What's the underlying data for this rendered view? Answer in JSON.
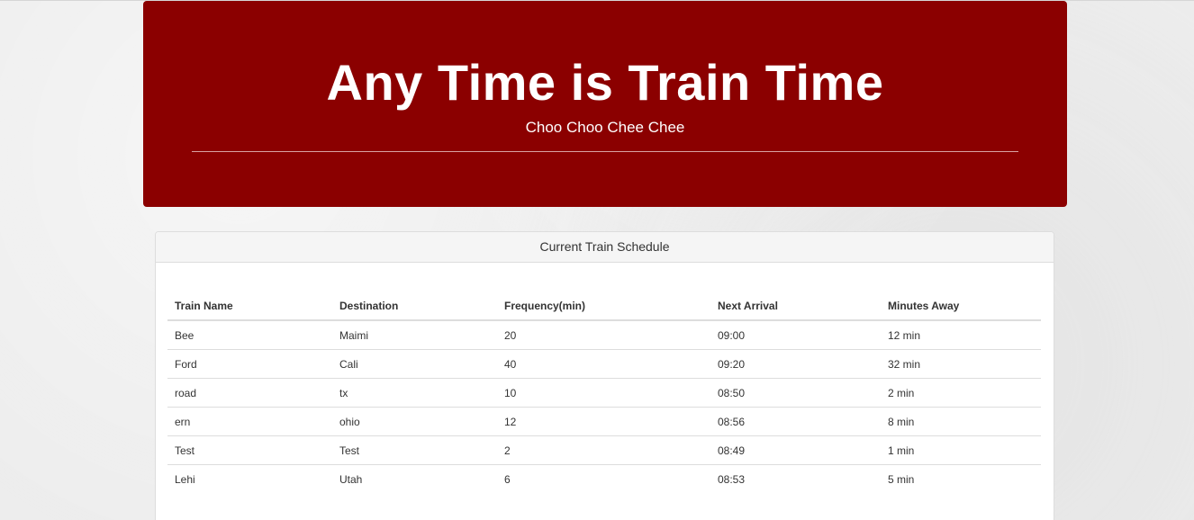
{
  "header": {
    "title": "Any Time is Train Time",
    "subtitle": "Choo Choo Chee Chee"
  },
  "schedule": {
    "panel_title": "Current Train Schedule",
    "columns": [
      "Train Name",
      "Destination",
      "Frequency(min)",
      "Next Arrival",
      "Minutes Away"
    ],
    "rows": [
      [
        "Bee",
        "Maimi",
        "20",
        "09:00",
        "12 min"
      ],
      [
        "Ford",
        "Cali",
        "40",
        "09:20",
        "32 min"
      ],
      [
        "road",
        "tx",
        "10",
        "08:50",
        "2 min"
      ],
      [
        "ern",
        "ohio",
        "12",
        "08:56",
        "8 min"
      ],
      [
        "Test",
        "Test",
        "2",
        "08:49",
        "1 min"
      ],
      [
        "Lehi",
        "Utah",
        "6",
        "08:53",
        "5 min"
      ]
    ]
  },
  "colors": {
    "header_background": "#8b0000",
    "page_background": "#ededed"
  }
}
